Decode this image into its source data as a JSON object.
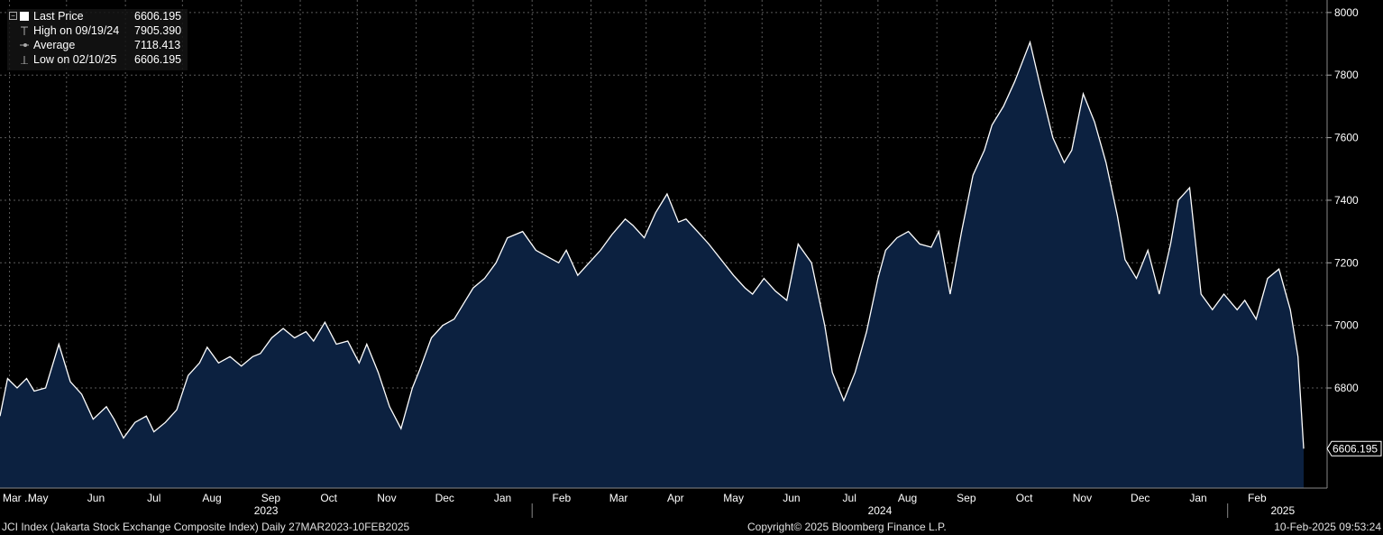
{
  "legend": {
    "rows": [
      {
        "label": "Last Price",
        "value": "6606.195",
        "marker": "square-icon"
      },
      {
        "label": "High on 09/19/24",
        "value": "7905.390",
        "marker": "high-marker-icon"
      },
      {
        "label": "Average",
        "value": "7118.413",
        "marker": "average-marker-icon"
      },
      {
        "label": "Low on 02/10/25",
        "value": "6606.195",
        "marker": "low-marker-icon"
      }
    ]
  },
  "last_price_label": "6606.195",
  "footer": {
    "security": "JCI Index (Jakarta Stock Exchange Composite Index)  Daily 27MAR2023-10FEB2025",
    "copyright": "Copyright© 2025 Bloomberg Finance L.P.",
    "timestamp": "10-Feb-2025 09:53:24"
  },
  "colors": {
    "background": "#000000",
    "area_fill": "#0c2140",
    "line": "#ffffff",
    "grid": "#5a5a5a"
  },
  "chart_data": {
    "type": "area",
    "title": "",
    "xlabel": "",
    "ylabel": "",
    "ylim": [
      6480,
      8040
    ],
    "y_ticks": [
      6800,
      7000,
      7200,
      7400,
      7600,
      7800,
      8000
    ],
    "grid": true,
    "legend_position": "top-left",
    "month_ticks": [
      "Mar ...",
      "May",
      "Jun",
      "Jul",
      "Aug",
      "Sep",
      "Oct",
      "Nov",
      "Dec",
      "Jan",
      "Feb",
      "Mar",
      "Apr",
      "May",
      "Jun",
      "Jul",
      "Aug",
      "Sep",
      "Oct",
      "Nov",
      "Dec",
      "Jan",
      "Feb"
    ],
    "year_labels": [
      "2023",
      "2024",
      "2025"
    ],
    "series": [
      {
        "x": [
          "2023-03-27",
          "2023-03-31",
          "2023-04-05",
          "2023-04-10",
          "2023-04-14",
          "2023-04-20",
          "2023-04-27",
          "2023-05-03",
          "2023-05-09",
          "2023-05-15",
          "2023-05-22",
          "2023-05-26",
          "2023-05-31",
          "2023-06-06",
          "2023-06-12",
          "2023-06-16",
          "2023-06-22",
          "2023-06-28",
          "2023-07-04",
          "2023-07-10",
          "2023-07-14",
          "2023-07-20",
          "2023-07-26",
          "2023-08-01",
          "2023-08-07",
          "2023-08-11",
          "2023-08-17",
          "2023-08-23",
          "2023-08-29",
          "2023-09-04",
          "2023-09-08",
          "2023-09-14",
          "2023-09-20",
          "2023-09-26",
          "2023-10-02",
          "2023-10-06",
          "2023-10-12",
          "2023-10-18",
          "2023-10-24",
          "2023-10-30",
          "2023-11-03",
          "2023-11-09",
          "2023-11-15",
          "2023-11-21",
          "2023-11-27",
          "2023-12-01",
          "2023-12-07",
          "2023-12-13",
          "2023-12-19",
          "2023-12-27",
          "2024-01-03",
          "2024-01-09",
          "2024-01-15",
          "2024-01-19",
          "2024-01-25",
          "2024-01-31",
          "2024-02-06",
          "2024-02-12",
          "2024-02-19",
          "2024-02-23",
          "2024-02-29",
          "2024-03-06",
          "2024-03-12",
          "2024-03-18",
          "2024-03-22",
          "2024-03-28",
          "2024-04-03",
          "2024-04-16",
          "2024-04-22",
          "2024-04-26",
          "2024-05-02",
          "2024-05-08",
          "2024-05-14",
          "2024-05-20",
          "2024-05-27",
          "2024-06-03",
          "2024-06-07",
          "2024-06-13",
          "2024-06-19",
          "2024-06-25",
          "2024-07-01",
          "2024-07-05",
          "2024-07-11",
          "2024-07-17",
          "2024-07-23",
          "2024-07-29",
          "2024-08-02",
          "2024-08-08",
          "2024-08-14",
          "2024-08-20",
          "2024-08-26",
          "2024-08-30",
          "2024-09-05",
          "2024-09-11",
          "2024-09-19",
          "2024-09-25",
          "2024-10-01",
          "2024-10-07",
          "2024-10-11",
          "2024-10-17",
          "2024-10-23",
          "2024-10-29",
          "2024-11-04",
          "2024-11-08",
          "2024-11-14",
          "2024-11-20",
          "2024-11-26",
          "2024-12-02",
          "2024-12-06",
          "2024-12-12",
          "2024-12-18",
          "2024-12-24",
          "2024-12-30",
          "2025-01-06",
          "2025-01-10",
          "2025-01-16",
          "2025-01-22",
          "2025-01-28",
          "2025-02-03",
          "2025-02-07",
          "2025-02-10"
        ],
        "y": [
          6710,
          6830,
          6800,
          6830,
          6790,
          6800,
          6940,
          6820,
          6780,
          6700,
          6740,
          6700,
          6640,
          6690,
          6710,
          6660,
          6690,
          6730,
          6840,
          6880,
          6930,
          6880,
          6900,
          6870,
          6900,
          6910,
          6960,
          6990,
          6960,
          6980,
          6950,
          7010,
          6940,
          6950,
          6880,
          6940,
          6850,
          6740,
          6670,
          6800,
          6860,
          6960,
          7000,
          7020,
          7080,
          7120,
          7150,
          7200,
          7280,
          7300,
          7240,
          7220,
          7200,
          7240,
          7160,
          7200,
          7240,
          7290,
          7340,
          7320,
          7280,
          7360,
          7420,
          7330,
          7340,
          7300,
          7260,
          7160,
          7120,
          7100,
          7150,
          7110,
          7080,
          7260,
          7200,
          7000,
          6850,
          6760,
          6850,
          6980,
          7150,
          7240,
          7280,
          7300,
          7260,
          7250,
          7300,
          7100,
          7300,
          7480,
          7560,
          7640,
          7700,
          7780,
          7905,
          7750,
          7600,
          7520,
          7560,
          7740,
          7650,
          7520,
          7350,
          7210,
          7150,
          7240,
          7100,
          7260,
          7400,
          7440,
          7100,
          7050,
          7100,
          7050,
          7080,
          7020,
          7150,
          7180,
          7050,
          6900,
          6606
        ]
      }
    ]
  }
}
